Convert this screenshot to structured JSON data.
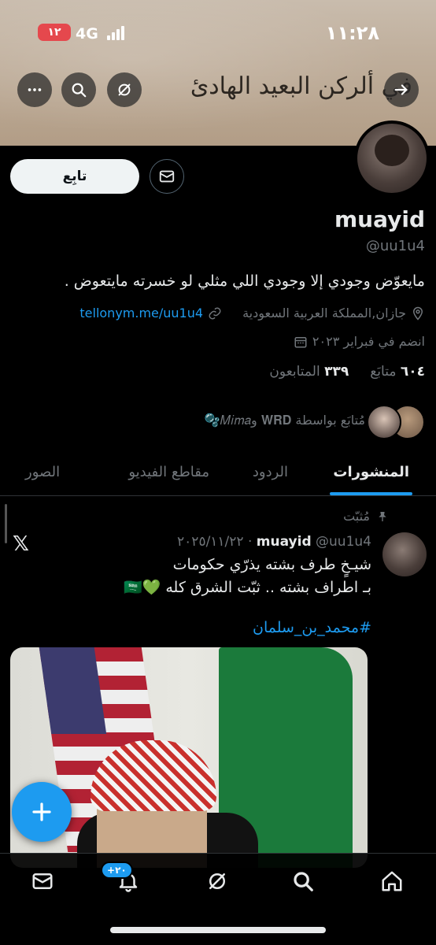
{
  "status_bar": {
    "time": "١١:٢٨",
    "network": "4G",
    "battery": "١٢"
  },
  "banner": {
    "calligraphy": "في ألركن البعيد الهادئ"
  },
  "profile": {
    "follow_label": "تابِع",
    "name": "muayid",
    "handle": "@uu1u4",
    "bio": "مايعوّض وجودي إلا وجودي اللي مثلي لو خسرته مايتعوض .",
    "location": "جازان,المملكة العربية السعودية",
    "link": "tellonym.me/uu1u4",
    "joined": "انضم في فبراير ٢٠٢٣",
    "following_count": "٦٠٤",
    "following_label": "متابَع",
    "followers_count": "٣٣٩",
    "followers_label": "المتابعون",
    "followed_by": "مُتابَع بواسطة 𝐖𝐑𝐃 و𝑀𝑖𝑚𝑎🫧"
  },
  "tabs": [
    {
      "label": "المنشورات",
      "active": true
    },
    {
      "label": "الردود",
      "active": false
    },
    {
      "label": "مقاطع الفيديو",
      "active": false
    },
    {
      "label": "الصور",
      "active": false
    }
  ],
  "post": {
    "pinned_label": "مُثبّت",
    "author": "muayid",
    "handle_date": "@uu1u4 · ٢٠٢٥/١١/٢٢",
    "line1": "شيـخٍ طرف بشته يذرّي حكومات",
    "line2": "بـ اطراف بشته .. ثبّت الشرق كله 💚🇸🇦",
    "hashtag": "#محمد_بن_سلمان"
  },
  "bottom_nav": {
    "notifications_badge": "+٢٠"
  },
  "colors": {
    "accent": "#1d9bf0",
    "background": "#000000",
    "muted": "#71767b"
  }
}
